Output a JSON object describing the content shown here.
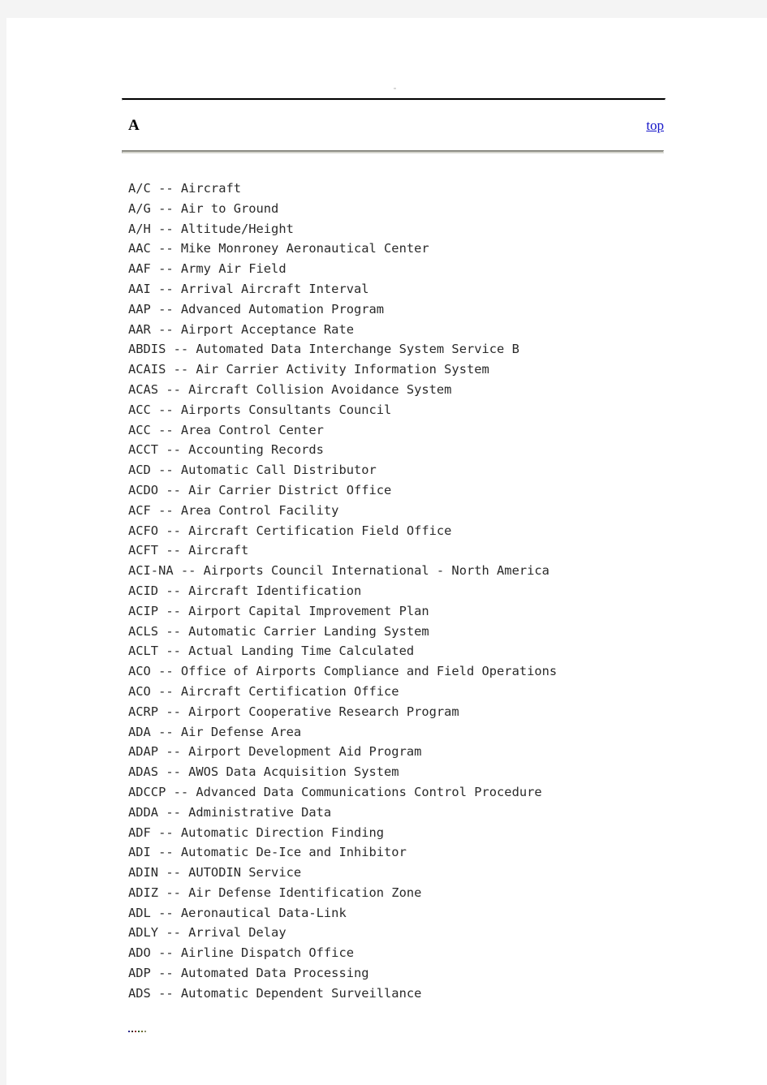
{
  "page": {
    "section_letter": "A",
    "top_link_label": "top",
    "background_color": "#ffffff",
    "band_color": "#f4f4f4",
    "link_color": "#1414c8",
    "rule_top_color": "#000000",
    "rule_bottom_color": "#8d8d85"
  },
  "abbreviations": [
    "A/C -- Aircraft",
    "A/G -- Air to Ground",
    "A/H -- Altitude/Height",
    "AAC -- Mike Monroney Aeronautical Center",
    "AAF -- Army Air Field",
    "AAI -- Arrival Aircraft Interval",
    "AAP -- Advanced Automation Program",
    "AAR -- Airport Acceptance Rate",
    "ABDIS -- Automated Data Interchange System Service B",
    "ACAIS -- Air Carrier Activity Information System",
    "ACAS -- Aircraft Collision Avoidance System",
    "ACC -- Airports Consultants Council",
    "ACC -- Area Control Center",
    "ACCT -- Accounting Records",
    "ACD -- Automatic Call Distributor",
    "ACDO -- Air Carrier District Office",
    "ACF -- Area Control Facility",
    "ACFO -- Aircraft Certification Field Office",
    "ACFT -- Aircraft",
    "ACI-NA -- Airports Council International - North America",
    "ACID -- Aircraft Identification",
    "ACIP -- Airport Capital Improvement Plan",
    "ACLS -- Automatic Carrier Landing System",
    "ACLT -- Actual Landing Time Calculated",
    "ACO -- Office of Airports Compliance and Field Operations",
    "ACO -- Aircraft Certification Office",
    "ACRP -- Airport Cooperative Research Program",
    "ADA -- Air Defense Area",
    "ADAP -- Airport Development Aid Program",
    "ADAS -- AWOS Data Acquisition System",
    "ADCCP -- Advanced Data Communications Control Procedure",
    "ADDA -- Administrative Data",
    "ADF -- Automatic Direction Finding",
    "ADI -- Automatic De-Ice and Inhibitor",
    "ADIN -- AUTODIN Service",
    "ADIZ -- Air Defense Identification Zone",
    "ADL -- Aeronautical Data-Link",
    "ADLY -- Arrival Delay",
    "ADO -- Airline Dispatch Office",
    "ADP -- Automated Data Processing",
    "ADS -- Automatic Dependent Surveillance"
  ],
  "footer_marker": {
    "dot_colors": [
      "#2a2a8c",
      "#3a2a2a",
      "#8c2a2a",
      "#2a5a2a",
      "#6a6a2a",
      "#8a8a6a"
    ]
  }
}
